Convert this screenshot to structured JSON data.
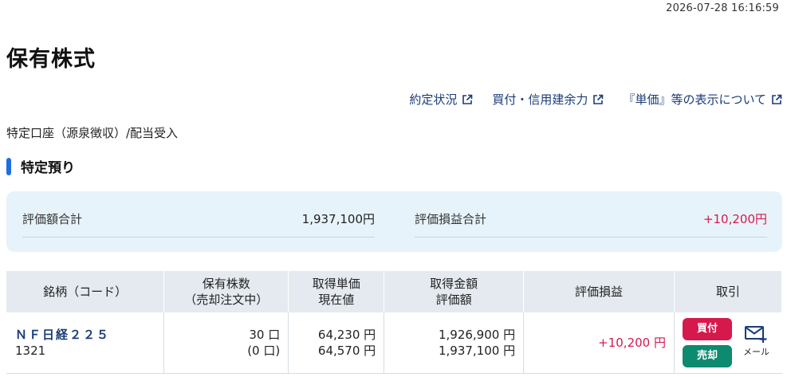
{
  "timestamp": "2026-07-28 16:16:59",
  "page_title": "保有株式",
  "links": [
    {
      "label": "約定状況",
      "icon": "external-link-icon"
    },
    {
      "label": "買付・信用建余力",
      "icon": "external-link-icon"
    },
    {
      "label": "『単価』等の表示について",
      "icon": "external-link-icon"
    }
  ],
  "account_type": "特定口座（源泉徴収）/配当受入",
  "section_title": "特定預り",
  "summary": {
    "valuation_total_label": "評価額合計",
    "valuation_total_value": "1,937,100円",
    "pl_total_label": "評価損益合計",
    "pl_total_value": "+10,200円"
  },
  "table": {
    "headers": {
      "name": "銘柄（コード）",
      "qty_line1": "保有株数",
      "qty_line2": "（売却注文中）",
      "price_line1": "取得単価",
      "price_line2": "現在値",
      "amount_line1": "取得金額",
      "amount_line2": "評価額",
      "pl": "評価損益",
      "trade": "取引"
    },
    "rows": [
      {
        "name": "ＮＦ日経２２５",
        "code": "1321",
        "qty": "30 口",
        "qty_pending": "(0 口)",
        "acq_price": "64,230 円",
        "current_price": "64,570 円",
        "acq_amount": "1,926,900 円",
        "valuation": "1,937,100 円",
        "pl": "+10,200 円",
        "buy_label": "買付",
        "sell_label": "売却",
        "mail_label": "メール"
      }
    ]
  },
  "colors": {
    "accent": "#1d6ee0",
    "link": "#1a3c78",
    "profit": "#d6194c",
    "buy": "#d6194c",
    "sell": "#0d8a6f",
    "summary_bg": "#e7f3fa"
  }
}
